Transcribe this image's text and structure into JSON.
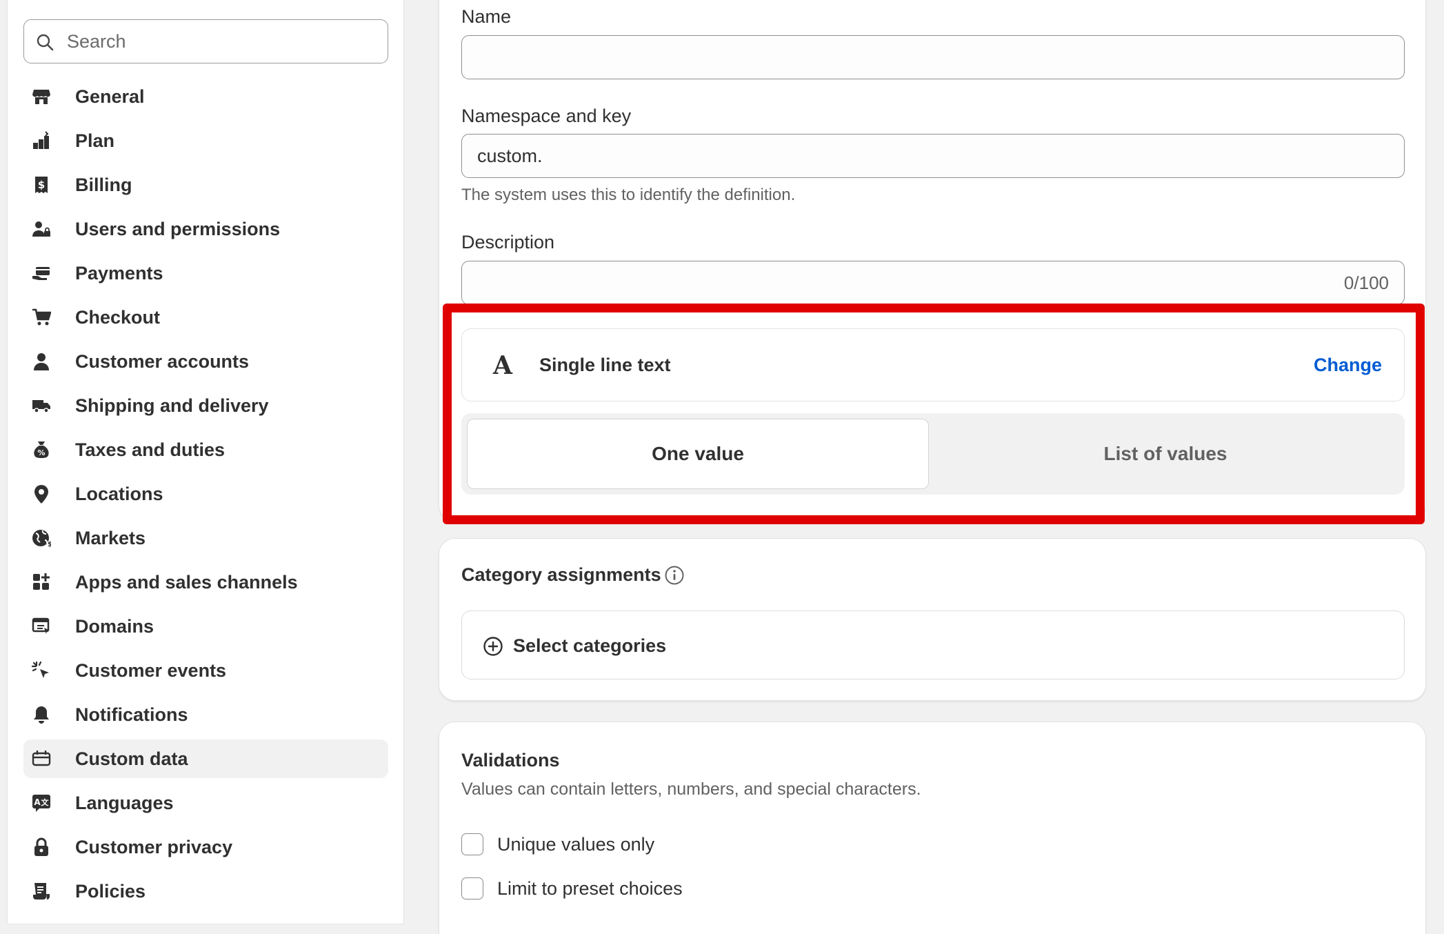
{
  "sidebar": {
    "search_placeholder": "Search",
    "active_item": "Custom data",
    "items": [
      {
        "label": "General",
        "icon": "store-icon"
      },
      {
        "label": "Plan",
        "icon": "plan-icon"
      },
      {
        "label": "Billing",
        "icon": "receipt-icon"
      },
      {
        "label": "Users and permissions",
        "icon": "users-icon"
      },
      {
        "label": "Payments",
        "icon": "payment-hand-icon"
      },
      {
        "label": "Checkout",
        "icon": "cart-icon"
      },
      {
        "label": "Customer accounts",
        "icon": "person-icon"
      },
      {
        "label": "Shipping and delivery",
        "icon": "truck-icon"
      },
      {
        "label": "Taxes and duties",
        "icon": "tax-bag-icon"
      },
      {
        "label": "Locations",
        "icon": "location-pin-icon"
      },
      {
        "label": "Markets",
        "icon": "globe-icon"
      },
      {
        "label": "Apps and sales channels",
        "icon": "apps-icon"
      },
      {
        "label": "Domains",
        "icon": "domains-icon"
      },
      {
        "label": "Customer events",
        "icon": "cursor-click-icon"
      },
      {
        "label": "Notifications",
        "icon": "bell-icon"
      },
      {
        "label": "Custom data",
        "icon": "custom-data-icon"
      },
      {
        "label": "Languages",
        "icon": "language-icon"
      },
      {
        "label": "Customer privacy",
        "icon": "lock-icon"
      },
      {
        "label": "Policies",
        "icon": "policy-icon"
      }
    ]
  },
  "definition": {
    "name_label": "Name",
    "name_value": "",
    "namespace_label": "Namespace and key",
    "namespace_value": "custom.",
    "namespace_help": "The system uses this to identify the definition.",
    "description_label": "Description",
    "description_value": "",
    "description_counter": "0/100",
    "type_glyph": "A",
    "type_name": "Single line text",
    "change_label": "Change",
    "value_mode": {
      "selected": "One value",
      "options": [
        "One value",
        "List of values"
      ]
    }
  },
  "categories": {
    "title": "Category assignments",
    "select_label": "Select categories"
  },
  "validations": {
    "title": "Validations",
    "description": "Values can contain letters, numbers, and special characters.",
    "options": [
      {
        "label": "Unique values only",
        "checked": false
      },
      {
        "label": "Limit to preset choices",
        "checked": false
      }
    ]
  },
  "colors": {
    "highlight": "#e00000",
    "link": "#005bd3",
    "active_nav_bg": "#f1f1f1"
  }
}
